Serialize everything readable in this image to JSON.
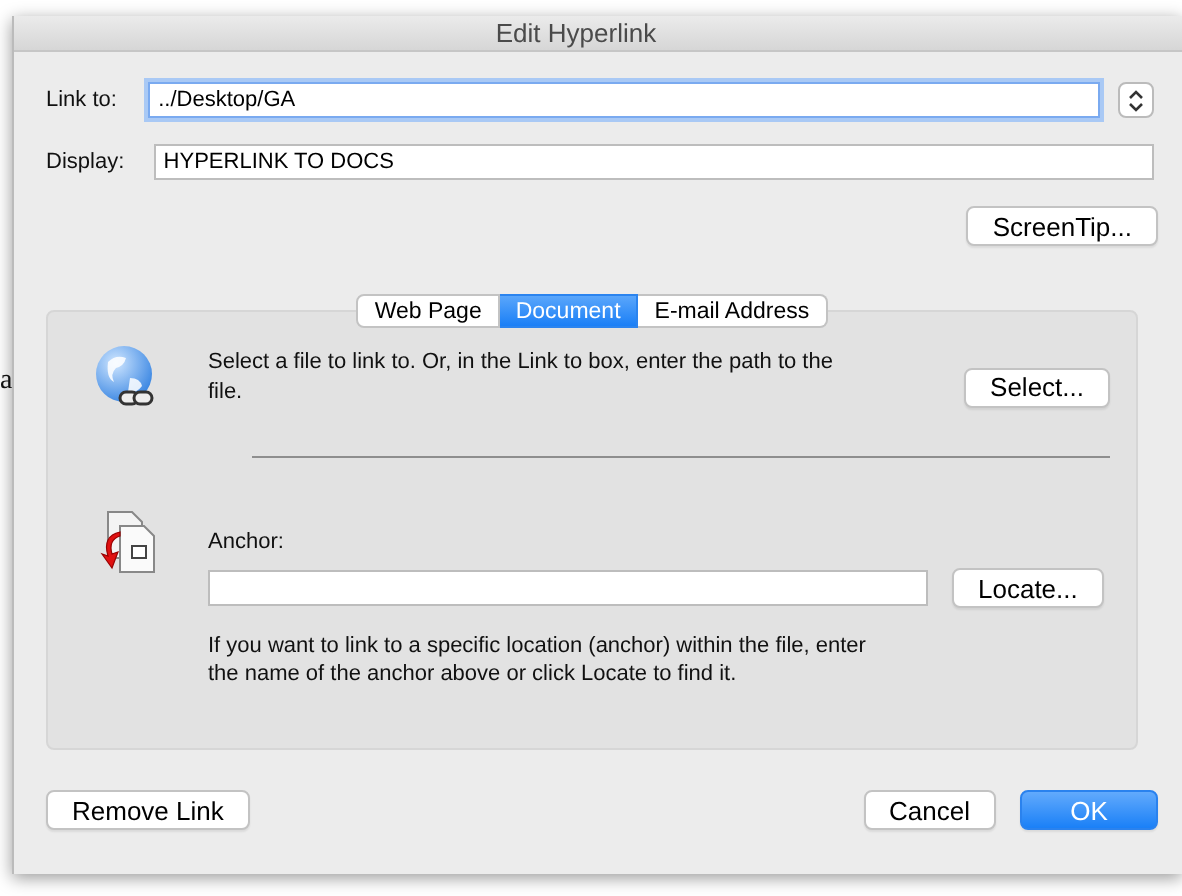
{
  "background_document": {
    "side_text": "a"
  },
  "window": {
    "title": "Edit Hyperlink"
  },
  "link_to": {
    "label": "Link to:",
    "value": "../Desktop/GA"
  },
  "display": {
    "label": "Display:",
    "value": "HYPERLINK TO DOCS"
  },
  "screentip_button": "ScreenTip...",
  "tabs": [
    {
      "label": "Web Page",
      "selected": false
    },
    {
      "label": "Document",
      "selected": true
    },
    {
      "label": "E-mail Address",
      "selected": false
    }
  ],
  "file_section": {
    "text": "Select a file to link to. Or, in the Link to box, enter the path to the file.",
    "button": "Select..."
  },
  "anchor_section": {
    "label": "Anchor:",
    "button": "Locate...",
    "help": "If you want to link to a specific location (anchor) within the file, enter the name of the anchor above or click Locate to find it."
  },
  "buttons": [
    {
      "label": "Remove Link",
      "kind": "secondary"
    },
    {
      "label": "Cancel",
      "kind": "secondary"
    },
    {
      "label": "OK",
      "kind": "default"
    }
  ]
}
